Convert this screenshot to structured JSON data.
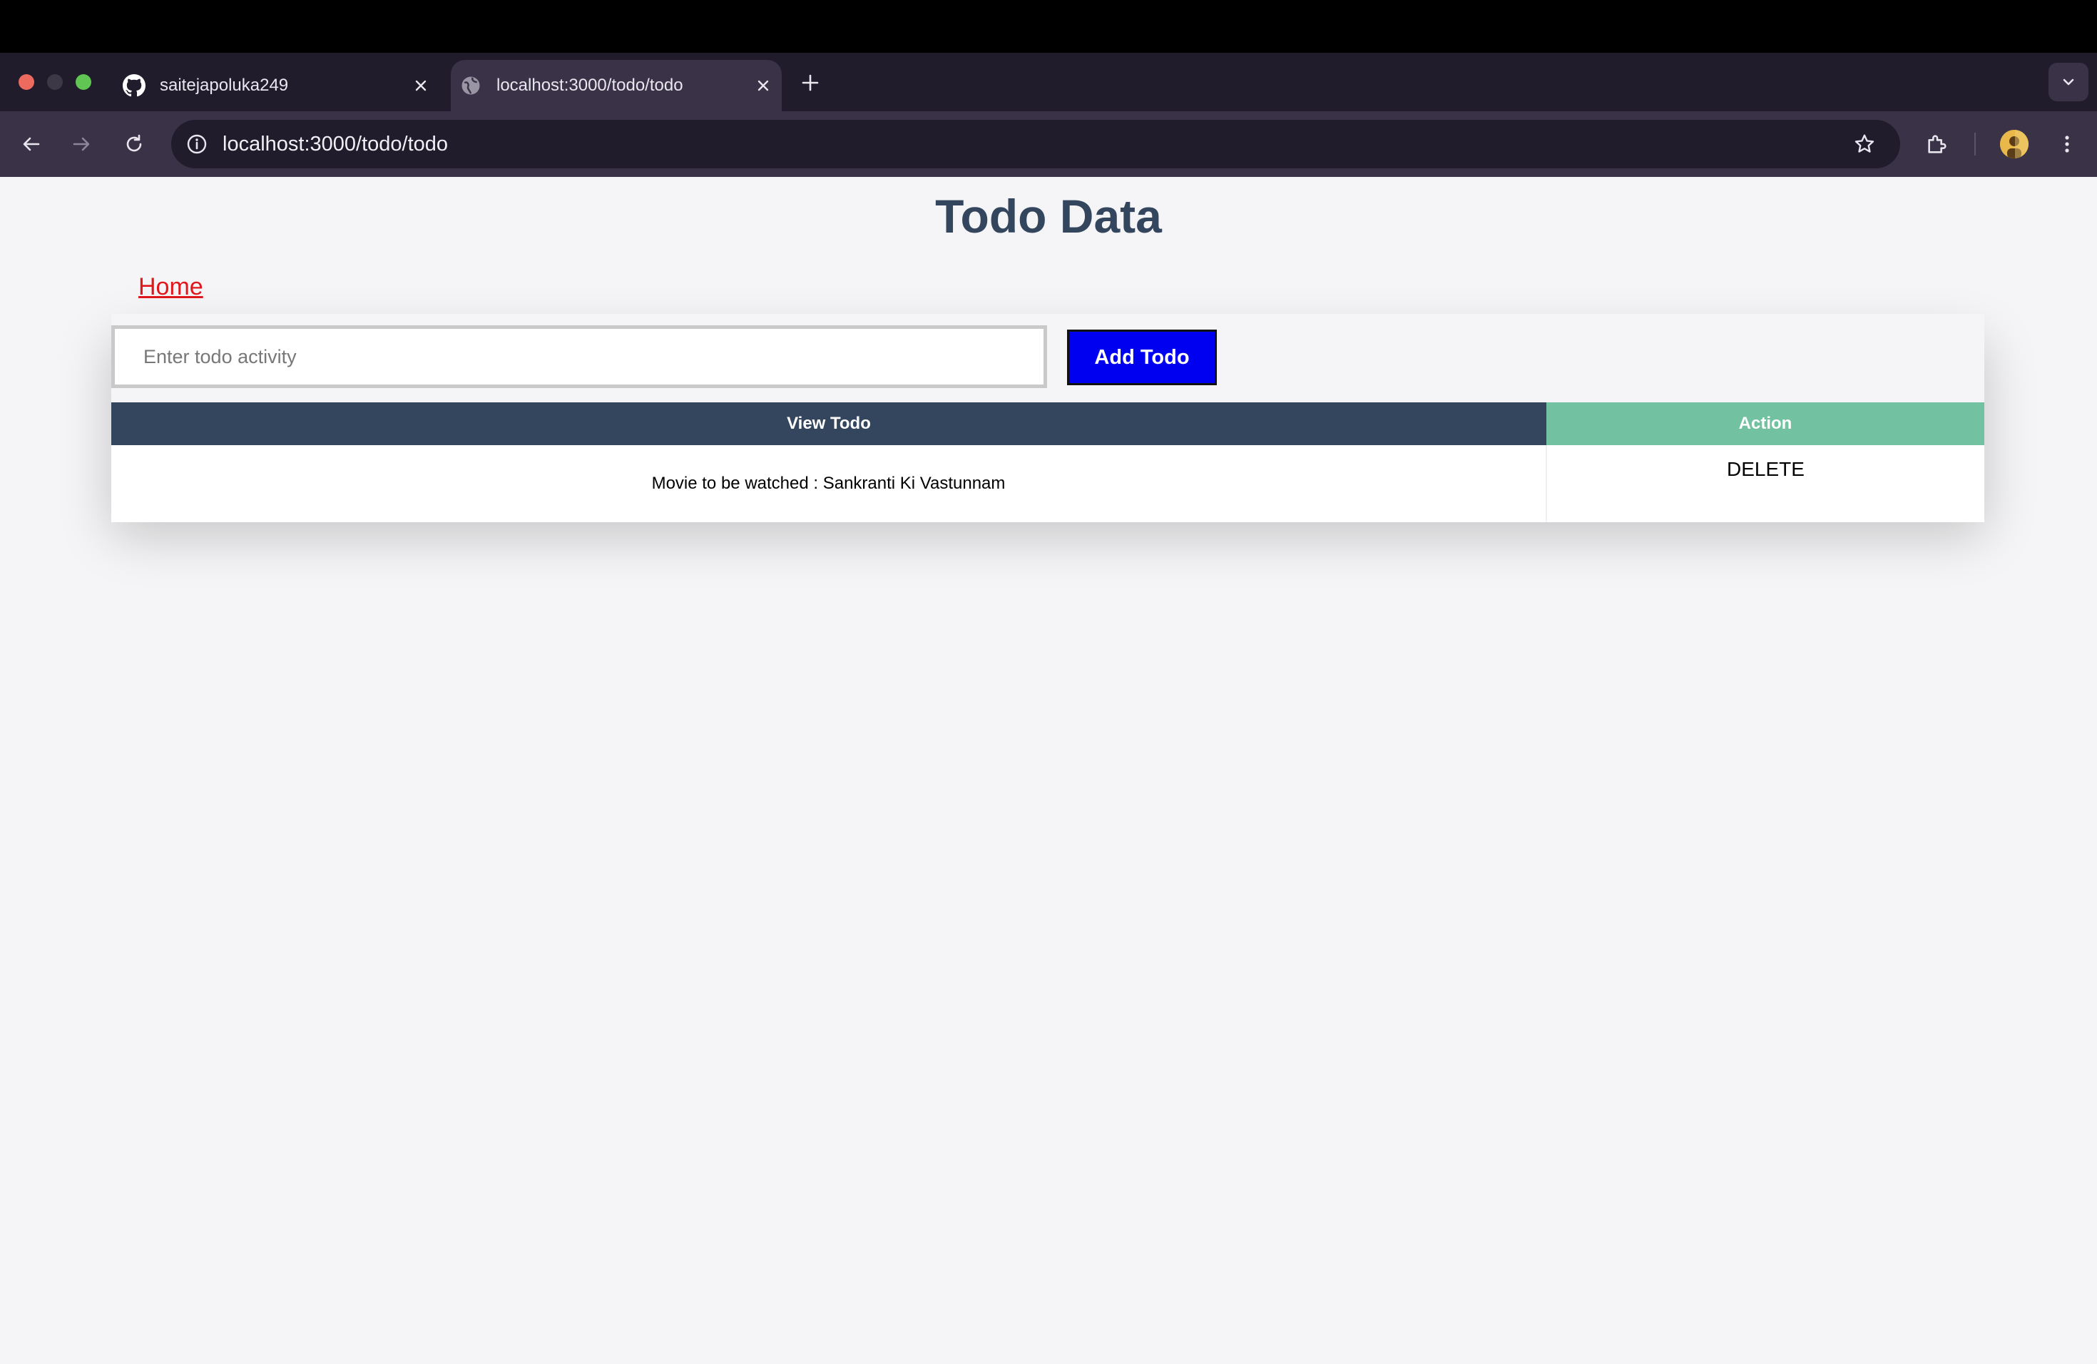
{
  "browser": {
    "tabs": [
      {
        "title": "saitejapoluka249",
        "icon": "github-icon"
      },
      {
        "title": "localhost:3000/todo/todo",
        "icon": "globe-icon",
        "active": true
      }
    ],
    "address_bar": {
      "url": "localhost:3000/todo/todo"
    }
  },
  "page": {
    "title": "Todo Data",
    "home_link": "Home",
    "input_placeholder": "Enter todo activity",
    "input_value": "",
    "add_button": "Add Todo",
    "table": {
      "headers": {
        "view": "View Todo",
        "action": "Action"
      },
      "rows": [
        {
          "text": "Movie to be watched : Sankranti Ki Vastunnam",
          "action": "DELETE"
        }
      ]
    }
  },
  "colors": {
    "title": "#34465e",
    "link": "#e0181c",
    "add_button_bg": "#0000f0",
    "view_header_bg": "#34465e",
    "action_header_bg": "#72c1a1",
    "page_bg": "#f5f5f7"
  }
}
